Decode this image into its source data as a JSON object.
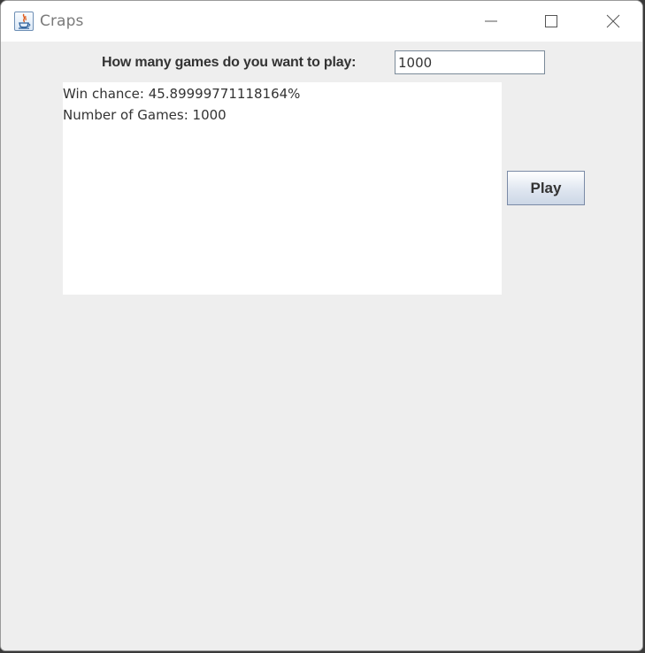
{
  "window": {
    "title": "Craps",
    "icon": "java-cup-icon",
    "controls": [
      "minimize-icon",
      "maximize-icon",
      "close-icon"
    ]
  },
  "form": {
    "prompt_label": "How many games do you want to play:",
    "games_value": "1000"
  },
  "output": {
    "lines": [
      "Win chance: 45.89999771118164%",
      "Number of Games: 1000"
    ]
  },
  "actions": {
    "play_label": "Play"
  },
  "colors": {
    "background": "#eeeeee",
    "titlebar": "#ffffff",
    "text": "#333333"
  }
}
